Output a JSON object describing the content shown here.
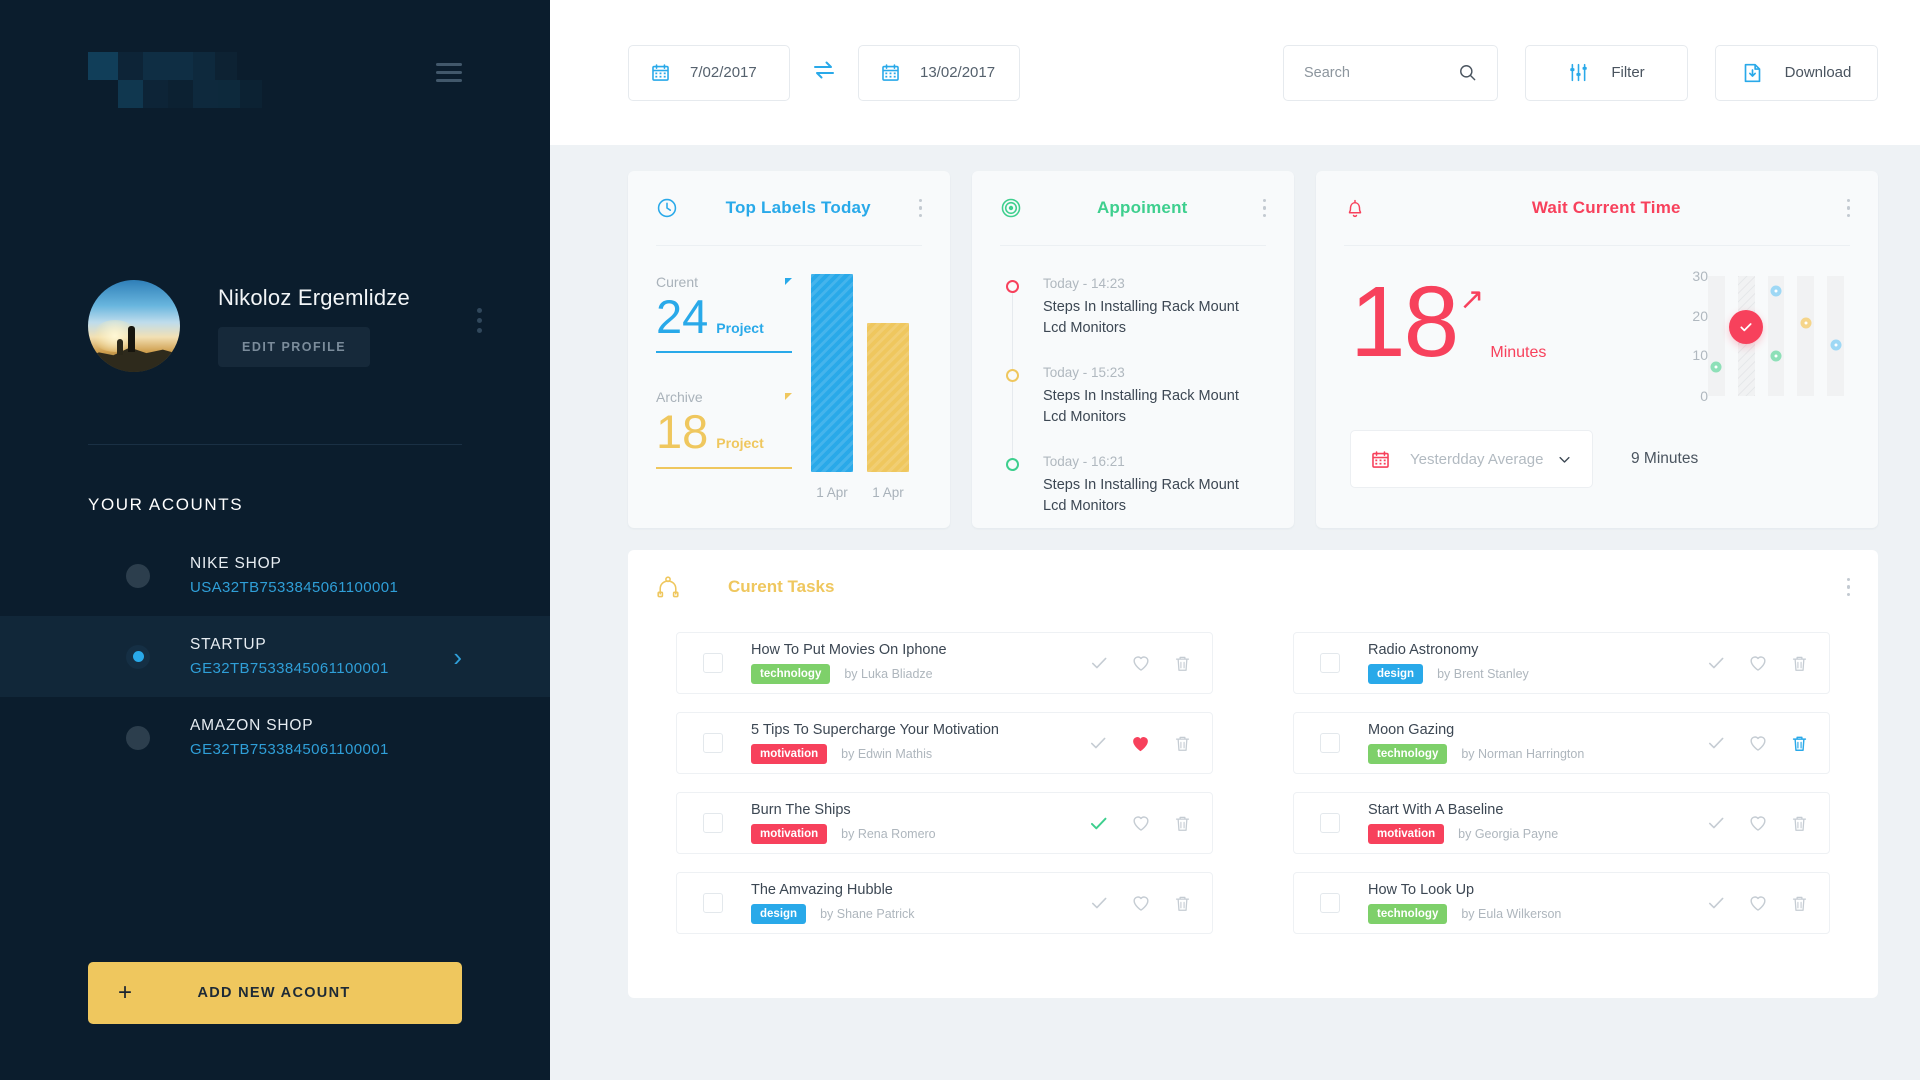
{
  "sidebar": {
    "logo_alt": "company-logo-redacted",
    "menu_icon": "hamburger-icon",
    "profile": {
      "name": "Nikoloz Ergemlidze",
      "edit_label": "EDIT PROFILE",
      "avatar_alt": "user-avatar-mountain-photo"
    },
    "accounts_heading": "YOUR ACOUNTS",
    "accounts": [
      {
        "name": "NIKE SHOP",
        "number": "USA32TB7533845061100001",
        "selected": false
      },
      {
        "name": "STARTUP",
        "number": "GE32TB7533845061100001",
        "selected": true
      },
      {
        "name": "AMAZON SHOP",
        "number": "GE32TB7533845061100001",
        "selected": false
      }
    ],
    "add_account_label": "ADD NEW ACOUNT",
    "add_account_plus": "+"
  },
  "topbar": {
    "date_from": "7/02/2017",
    "date_to": "13/02/2017",
    "swap_icon": "swap-arrows-icon",
    "calendar_icon": "calendar-icon",
    "search_placeholder": "Search",
    "search_value": "",
    "filter_label": "Filter",
    "download_label": "Download"
  },
  "cards": {
    "labels": {
      "title": "Top Labels Today",
      "icon": "clock-icon",
      "accent": "#29a9e9",
      "stats": [
        {
          "label": "Curent",
          "value": "24",
          "unit": "Project",
          "color": "#29a9e9"
        },
        {
          "label": "Archive",
          "value": "18",
          "unit": "Project",
          "color": "#efc75e"
        }
      ]
    },
    "appointment": {
      "title": "Appoiment",
      "icon": "target-icon",
      "accent": "#3ecf8e",
      "items": [
        {
          "time": "Today - 14:23",
          "text": "Steps In Installing Rack Mount Lcd Monitors",
          "dot_color": "#f7415c"
        },
        {
          "time": "Today - 15:23",
          "text": "Steps In Installing Rack Mount Lcd Monitors",
          "dot_color": "#efc75e"
        },
        {
          "time": "Today - 16:21",
          "text": "Steps In Installing Rack Mount Lcd Monitors",
          "dot_color": "#3ecf8e"
        }
      ]
    },
    "wait": {
      "title": "Wait Current Time",
      "icon": "bell-icon",
      "accent": "#f7415c",
      "value": "18",
      "unit": "Minutes",
      "trend_icon": "arrow-up-right-icon",
      "select_value": "Yesterdday Average",
      "select_icon": "calendar-icon",
      "compare_value": "9 Minutes"
    }
  },
  "chart_data": [
    {
      "type": "bar",
      "title": "Top Labels Today",
      "categories": [
        "1 Apr",
        "1 Apr"
      ],
      "values": [
        24,
        18
      ],
      "series": [
        {
          "name": "Curent",
          "values": [
            24
          ]
        },
        {
          "name": "Archive",
          "values": [
            18
          ]
        }
      ],
      "colors": [
        "#29a9e9",
        "#efc75e"
      ],
      "ylim": [
        0,
        26
      ],
      "xlabel": "",
      "ylabel": "",
      "grid": false,
      "legend": "none"
    },
    {
      "type": "scatter",
      "title": "Wait Current Time",
      "ylabel": "Minutes",
      "xlabel": "",
      "ylim": [
        0,
        33
      ],
      "yticks": [
        0,
        10,
        20,
        30
      ],
      "grid": false,
      "legend": "none",
      "bands": 5,
      "points": [
        {
          "band": 1,
          "y": 8,
          "color": "#8ee0b8",
          "marker": "dot"
        },
        {
          "band": 2,
          "y": 19,
          "color": "#f7415c",
          "marker": "check-badge"
        },
        {
          "band": 3,
          "y": 29,
          "color": "#9ed8f5",
          "marker": "dot"
        },
        {
          "band": 3,
          "y": 11,
          "color": "#8ee0b8",
          "marker": "dot"
        },
        {
          "band": 4,
          "y": 20,
          "color": "#f5d58a",
          "marker": "dot"
        },
        {
          "band": 5,
          "y": 14,
          "color": "#9ed8f5",
          "marker": "dot"
        }
      ]
    }
  ],
  "tasks": {
    "title": "Curent Tasks",
    "icon": "pen-tool-icon",
    "items": [
      {
        "title": "How To Put Movies On Iphone",
        "tag": "technology",
        "tag_class": "technology",
        "author": "by Luka Bliadze",
        "checked": false,
        "liked": false,
        "trash_active": false,
        "check_active": false
      },
      {
        "title": "Radio Astronomy",
        "tag": "design",
        "tag_class": "design",
        "author": "by Brent Stanley",
        "checked": false,
        "liked": false,
        "trash_active": false,
        "check_active": false
      },
      {
        "title": "5 Tips To Supercharge Your Motivation",
        "tag": "motivation",
        "tag_class": "motivation",
        "author": "by Edwin Mathis",
        "checked": false,
        "liked": true,
        "trash_active": false,
        "check_active": false
      },
      {
        "title": "Moon Gazing",
        "tag": "technology",
        "tag_class": "technology",
        "author": "by Norman Harrington",
        "checked": false,
        "liked": false,
        "trash_active": true,
        "check_active": false
      },
      {
        "title": "Burn The Ships",
        "tag": "motivation",
        "tag_class": "motivation",
        "author": "by Rena Romero",
        "checked": false,
        "liked": false,
        "trash_active": false,
        "check_active": true
      },
      {
        "title": "Start With A Baseline",
        "tag": "motivation",
        "tag_class": "motivation",
        "author": "by Georgia Payne",
        "checked": false,
        "liked": false,
        "trash_active": false,
        "check_active": false
      },
      {
        "title": "The Amvazing Hubble",
        "tag": "design",
        "tag_class": "design",
        "author": "by Shane Patrick",
        "checked": false,
        "liked": false,
        "trash_active": false,
        "check_active": false
      },
      {
        "title": "How To Look Up",
        "tag": "technology",
        "tag_class": "technology",
        "author": "by Eula Wilkerson",
        "checked": false,
        "liked": false,
        "trash_active": false,
        "check_active": false
      }
    ]
  }
}
